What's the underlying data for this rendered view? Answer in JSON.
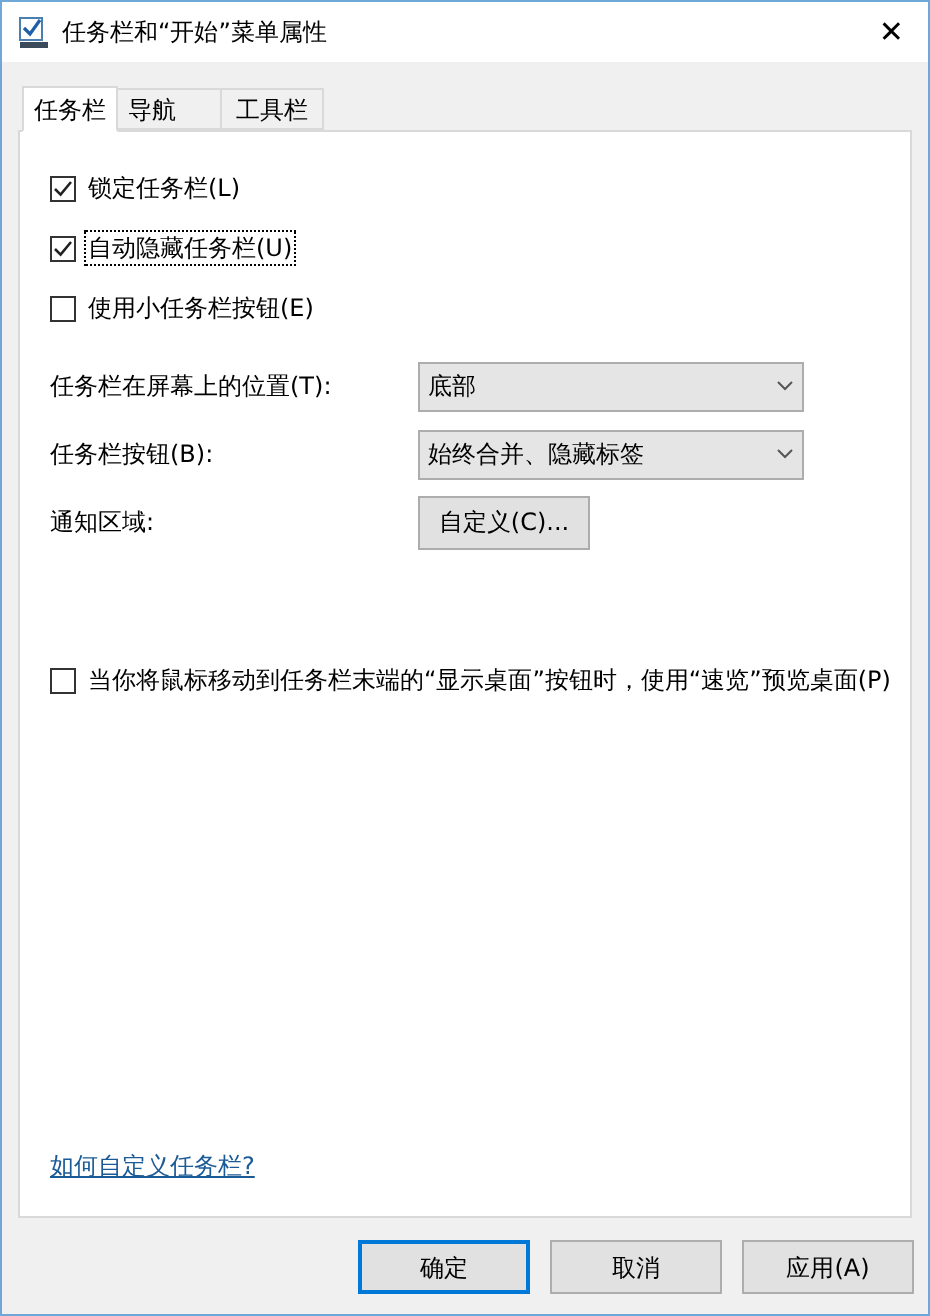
{
  "window": {
    "title": "任务栏和“开始”菜单属性",
    "close": "✕"
  },
  "tabs": [
    {
      "label": "任务栏",
      "selected": true
    },
    {
      "label": "导航",
      "selected": false
    },
    {
      "label": "工具栏",
      "selected": false
    }
  ],
  "checkboxes": [
    {
      "label": "锁定任务栏(L)",
      "checked": true,
      "focused": false
    },
    {
      "label": "自动隐藏任务栏(U)",
      "checked": true,
      "focused": true
    },
    {
      "label": "使用小任务栏按钮(E)",
      "checked": false,
      "focused": false
    }
  ],
  "settings": [
    {
      "kind": "dropdown",
      "label": "任务栏在屏幕上的位置(T):",
      "value": "底部"
    },
    {
      "kind": "dropdown",
      "label": "任务栏按钮(B):",
      "value": "始终合并、隐藏标签"
    },
    {
      "kind": "button",
      "label": "通知区域:",
      "value": "自定义(C)..."
    }
  ],
  "peek_checkbox": {
    "label": "当你将鼠标移动到任务栏末端的“显示桌面”按钮时，使用“速览”预览桌面(P)",
    "checked": false,
    "focused": false
  },
  "help_link": "如何自定义任务栏?",
  "buttons": [
    {
      "label": "确定",
      "default": true
    },
    {
      "label": "取消",
      "default": false
    },
    {
      "label": "应用(A)",
      "default": false
    }
  ]
}
